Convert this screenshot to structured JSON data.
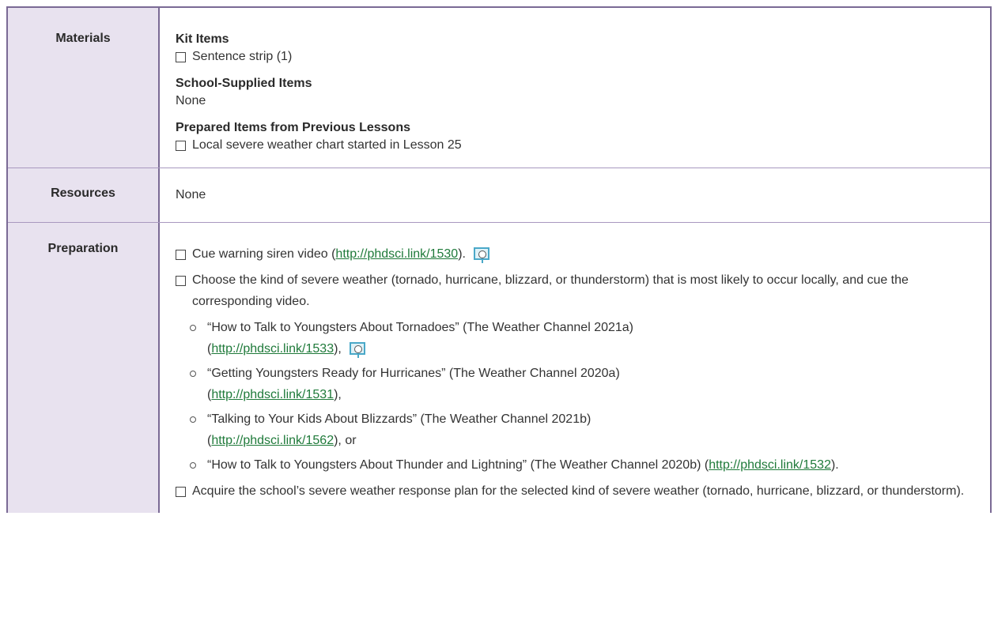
{
  "materials": {
    "label": "Materials",
    "kit_items": {
      "heading": "Kit Items",
      "items": [
        "Sentence strip (1)"
      ]
    },
    "school_supplied": {
      "heading": "School-Supplied Items",
      "text": "None"
    },
    "prepared_items": {
      "heading": "Prepared Items from Previous Lessons",
      "items": [
        "Local severe weather chart started in Lesson 25"
      ]
    }
  },
  "resources": {
    "label": "Resources",
    "text": "None"
  },
  "preparation": {
    "label": "Preparation",
    "item1": {
      "pre": "Cue warning siren video (",
      "link": "http://phdsci.link/1530",
      "post": ").",
      "icon": "presentation-icon"
    },
    "item2": {
      "text": "Choose the kind of severe weather (tornado, hurricane, blizzard, or thunderstorm) that is most likely to occur locally, and cue the corresponding video.",
      "videos": [
        {
          "title": "“How to Talk to Youngsters About Tornadoes” (The Weather Channel 2021a)",
          "pre": "(",
          "link": "http://phdsci.link/1533",
          "post": "),",
          "icon": "presentation-icon"
        },
        {
          "title": "“Getting Youngsters Ready for Hurricanes” (The Weather Channel 2020a)",
          "pre": "(",
          "link": "http://phdsci.link/1531",
          "post": "),"
        },
        {
          "title": "“Talking to Your Kids About Blizzards” (The Weather Channel 2021b)",
          "pre": "(",
          "link": "http://phdsci.link/1562",
          "post": "), or"
        },
        {
          "title": "“How to Talk to Youngsters About Thunder and Lightning” (The Weather Channel 2020b)",
          "pre": "(",
          "link": "http://phdsci.link/1532",
          "post": ")."
        }
      ]
    },
    "item3": {
      "text": "Acquire the school’s severe weather response plan for the selected kind of severe weather (tornado, hurricane, blizzard, or thunderstorm)."
    }
  },
  "colors": {
    "label_bg": "#e8e2ef",
    "border": "#7a6a95",
    "link": "#1f7a3a",
    "icon": "#4aa8c8"
  }
}
